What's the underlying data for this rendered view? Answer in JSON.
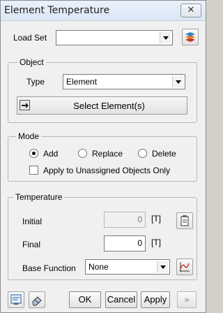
{
  "window": {
    "title": "Element Temperature",
    "close_glyph": "✕"
  },
  "load_set": {
    "label": "Load Set",
    "value": "",
    "side_icon": "load-set-manager-icon"
  },
  "object": {
    "group_title": "Object",
    "type_label": "Type",
    "type_value": "Element",
    "select_button_label": "Select Element(s)",
    "select_icon": "select-cursor-icon"
  },
  "mode": {
    "group_title": "Mode",
    "options": [
      "Add",
      "Replace",
      "Delete"
    ],
    "selected": "Add",
    "unassigned_label": "Apply to Unassigned Objects Only",
    "unassigned_checked": false
  },
  "temperature": {
    "group_title": "Temperature",
    "initial_label": "Initial",
    "initial_value": "0",
    "initial_unit": "[T]",
    "final_label": "Final",
    "final_value": "0",
    "final_unit": "[T]",
    "base_function_label": "Base Function",
    "base_function_value": "None",
    "initial_icon": "clipboard-icon",
    "base_function_icon": "function-plot-icon"
  },
  "footer": {
    "ok_label": "OK",
    "cancel_label": "Cancel",
    "apply_label": "Apply",
    "more_glyph": "»",
    "left_icons": [
      "notes-icon",
      "eraser-icon"
    ]
  }
}
